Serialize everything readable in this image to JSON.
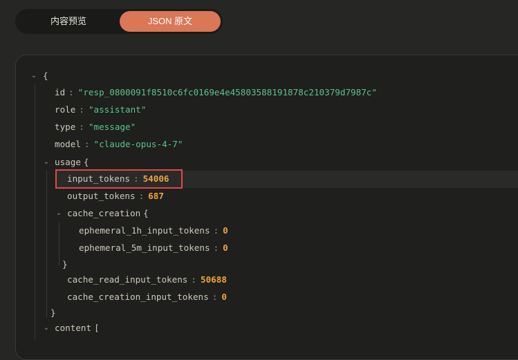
{
  "tabs": {
    "preview": "内容预览",
    "json": "JSON 原文"
  },
  "json": {
    "open_brace": "{",
    "id": {
      "key": "id",
      "value": "\"resp_0800091f8510c6fc0169e4e45803588191878c210379d7987c\""
    },
    "role": {
      "key": "role",
      "value": "\"assistant\""
    },
    "type": {
      "key": "type",
      "value": "\"message\""
    },
    "model": {
      "key": "model",
      "value": "\"claude-opus-4-7\""
    },
    "usage": {
      "key": "usage",
      "open": "{",
      "close": "}",
      "input_tokens": {
        "key": "input_tokens",
        "value": "54006"
      },
      "output_tokens": {
        "key": "output_tokens",
        "value": "687"
      },
      "cache_creation": {
        "key": "cache_creation",
        "open": "{",
        "close": "}",
        "ephemeral_1h": {
          "key": "ephemeral_1h_input_tokens",
          "value": "0"
        },
        "ephemeral_5m": {
          "key": "ephemeral_5m_input_tokens",
          "value": "0"
        }
      },
      "cache_read": {
        "key": "cache_read_input_tokens",
        "value": "50688"
      },
      "cache_creation_input": {
        "key": "cache_creation_input_tokens",
        "value": "0"
      }
    },
    "content": {
      "key": "content",
      "open": "["
    },
    "colon": ":",
    "chevron": "⌄"
  },
  "colors": {
    "accent": "#d97757",
    "string": "#5bc48a",
    "number": "#f0a63a",
    "highlight_border": "#e0484b"
  }
}
